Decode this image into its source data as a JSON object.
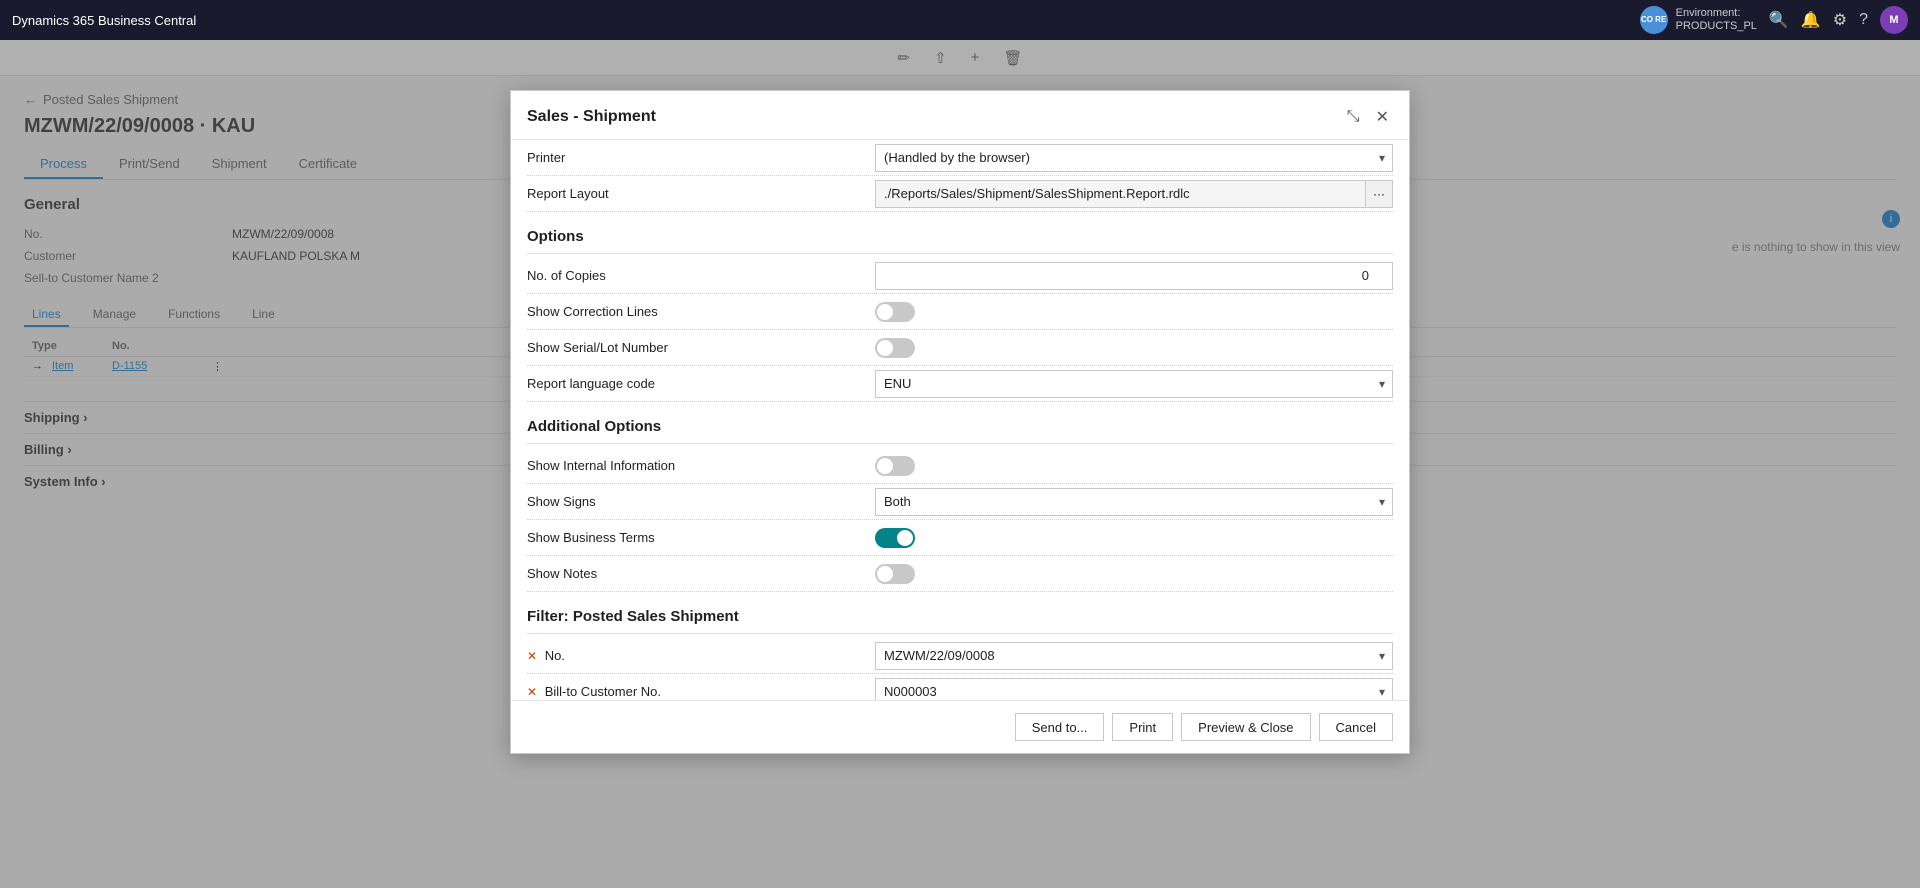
{
  "app": {
    "title": "Dynamics 365 Business Central"
  },
  "env": {
    "label": "Environment:",
    "name": "PRODUCTS_PL",
    "avatar_co": "CO RE",
    "avatar_m": "M"
  },
  "background_page": {
    "back_label": "←",
    "breadcrumb": "Posted Sales Shipment",
    "title": "MZWM/22/09/0008 · KAU",
    "toolbar_icons": [
      "✏",
      "⇧",
      "+",
      "🗑"
    ],
    "tabs": [
      "Process",
      "Print/Send",
      "Shipment",
      "Certificate"
    ],
    "section_general": "General",
    "fields": [
      {
        "label": "No.",
        "value": "MZWM/22/09/0008"
      },
      {
        "label": "Customer",
        "value": "KAUFLAND POLSKA M"
      },
      {
        "label": "Sell-to Customer Name 2",
        "value": ""
      }
    ],
    "lines_tabs": [
      "Lines",
      "Manage",
      "Functions",
      "Line"
    ],
    "table_headers": [
      "Type",
      "No.",
      ""
    ],
    "table_rows": [
      {
        "type": "Item",
        "no": "D-1155",
        "arrow": "→"
      }
    ],
    "sections": [
      "Shipping",
      "Billing",
      "System Info"
    ],
    "right_panel_text": "e is nothing to show in this view"
  },
  "modal": {
    "title": "Sales - Shipment",
    "printer_label": "Printer",
    "printer_value": "(Handled by the browser)",
    "printer_options": [
      "(Handled by the browser)"
    ],
    "report_layout_label": "Report Layout",
    "report_layout_value": "./Reports/Sales/Shipment/SalesShipment.Report.rdlc",
    "options_section": "Options",
    "fields_options": [
      {
        "label": "No. of Copies",
        "type": "number",
        "value": "0"
      },
      {
        "label": "Show Correction Lines",
        "type": "toggle",
        "on": false
      },
      {
        "label": "Show Serial/Lot Number",
        "type": "toggle",
        "on": false
      },
      {
        "label": "Report language code",
        "type": "select",
        "value": "ENU",
        "options": [
          "ENU"
        ]
      }
    ],
    "additional_options_section": "Additional Options",
    "fields_additional": [
      {
        "label": "Show Internal Information",
        "type": "toggle",
        "on": false
      },
      {
        "label": "Show Signs",
        "type": "select",
        "value": "Both",
        "options": [
          "Both"
        ]
      },
      {
        "label": "Show Business Terms",
        "type": "toggle",
        "on": true,
        "variant": "teal"
      },
      {
        "label": "Show Notes",
        "type": "toggle",
        "on": false
      }
    ],
    "filter_section": "Filter: Posted Sales Shipment",
    "filter_fields": [
      {
        "label": "No.",
        "value": "MZWM/22/09/0008",
        "has_x": true
      },
      {
        "label": "Bill-to Customer No.",
        "value": "N000003",
        "has_x": true
      }
    ],
    "buttons": [
      {
        "id": "send-to",
        "label": "Send to..."
      },
      {
        "id": "print",
        "label": "Print"
      },
      {
        "id": "preview-close",
        "label": "Preview & Close"
      },
      {
        "id": "cancel",
        "label": "Cancel"
      }
    ]
  }
}
